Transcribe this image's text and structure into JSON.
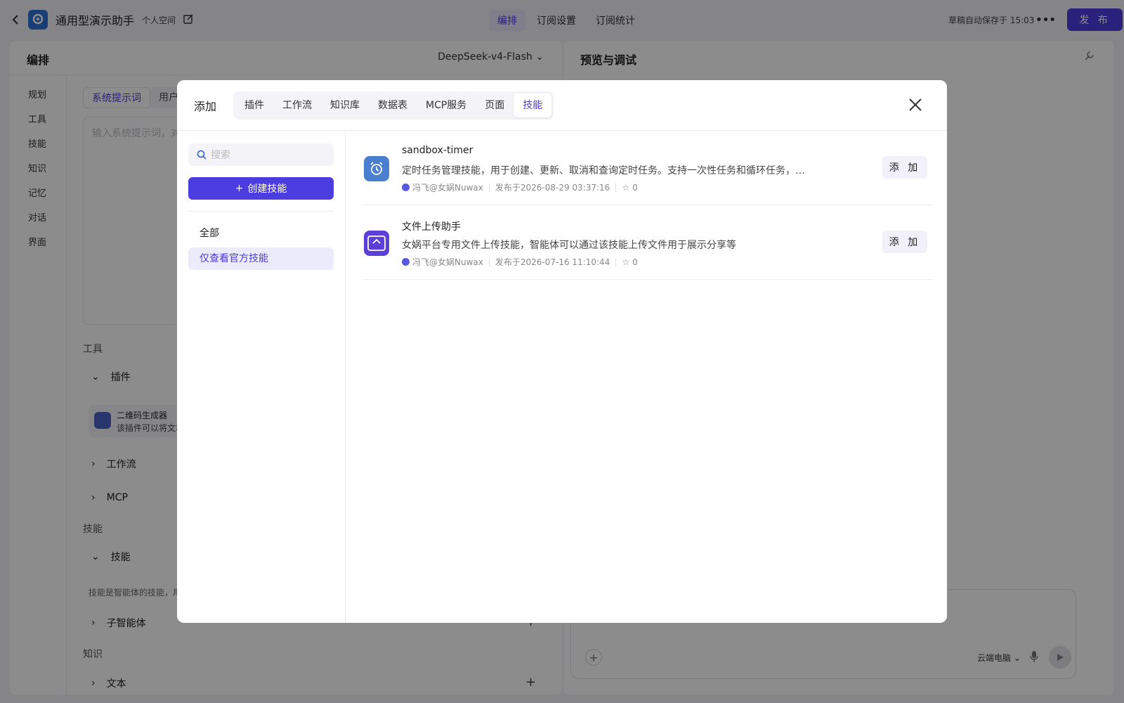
{
  "topbar": {
    "app_title": "通用型演示助手",
    "space_label": "个人空间",
    "tabs": [
      {
        "label": "编排",
        "active": true
      },
      {
        "label": "订阅设置",
        "active": false
      },
      {
        "label": "订阅统计",
        "active": false
      }
    ],
    "autosave": "草稿自动保存于 15:03",
    "publish_label": "发 布"
  },
  "left_panel": {
    "title": "编排",
    "model": "DeepSeek-v4-Flash",
    "nav": [
      "规划",
      "工具",
      "技能",
      "知识",
      "记忆",
      "对话",
      "界面"
    ],
    "prompt_tabs": [
      {
        "label": "系统提示词",
        "active": true
      },
      {
        "label": "用户",
        "active": false
      }
    ],
    "prompt_placeholder": "输入系统提示词，对",
    "tools_section": "工具",
    "plugin_row": "插件",
    "plugin_card": {
      "name": "二维码生成器",
      "desc": "该插件可以将文本"
    },
    "workflow_row": "工作流",
    "mcp_row": "MCP",
    "skills_section": "技能",
    "skills_row": "技能",
    "skills_hint": "技能是智能体的技能，用",
    "subagent_row": "子智能体",
    "knowledge_section": "知识",
    "text_row": "文本"
  },
  "right_panel": {
    "title": "预览与调试",
    "cloud_pc": "云端电脑"
  },
  "modal": {
    "title": "添加",
    "tabs": [
      {
        "label": "插件",
        "active": false
      },
      {
        "label": "工作流",
        "active": false
      },
      {
        "label": "知识库",
        "active": false
      },
      {
        "label": "数据表",
        "active": false
      },
      {
        "label": "MCP服务",
        "active": false
      },
      {
        "label": "页面",
        "active": false
      },
      {
        "label": "技能",
        "active": true
      }
    ],
    "search_placeholder": "搜索",
    "create_label": "创建技能",
    "filters": [
      {
        "label": "全部",
        "active": false
      },
      {
        "label": "仅查看官方技能",
        "active": true
      }
    ],
    "skills": [
      {
        "name": "sandbox-timer",
        "desc": "定时任务管理技能，用于创建、更新、取消和查询定时任务。支持一次性任务和循环任务，…",
        "author": "冯飞@女娲Nuwax",
        "published": "发布于2026-08-29 03:37:16",
        "stars": "0",
        "icon": "alarm-clock-icon",
        "icon_color": "#4a7fd0",
        "add_label": "添 加"
      },
      {
        "name": "文件上传助手",
        "desc": "女娲平台专用文件上传技能，智能体可以通过该技能上传文件用于展示分享等",
        "author": "冯飞@女娲Nuwax",
        "published": "发布于2026-07-16 11:10:44",
        "stars": "0",
        "icon": "upload-icon",
        "icon_color": "#5b3fd6",
        "add_label": "添 加"
      }
    ]
  },
  "colors": {
    "accent": "#4b3de0",
    "accent_text": "#4c3bd6",
    "overlay": "rgba(0,0,0,0.45)"
  }
}
